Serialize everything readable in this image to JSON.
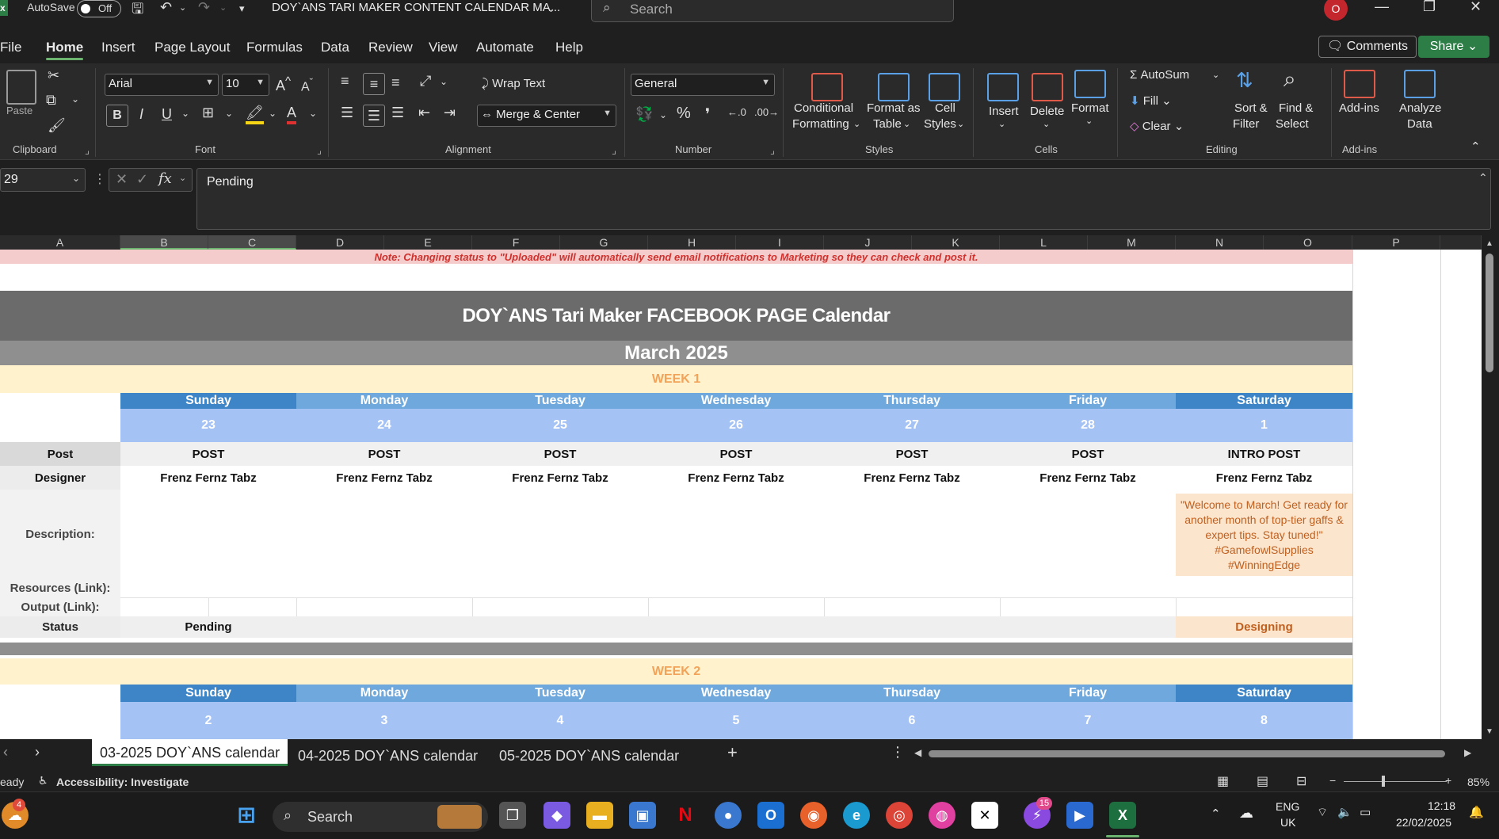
{
  "titlebar": {
    "autosave_label": "AutoSave",
    "autosave_state": "Off",
    "doc_title": "DOY`ANS TARI MAKER CONTENT CALENDAR MA...",
    "search_placeholder": "Search",
    "record_badge": "O"
  },
  "menu": [
    "File",
    "Home",
    "Insert",
    "Page Layout",
    "Formulas",
    "Data",
    "Review",
    "View",
    "Automate",
    "Help"
  ],
  "menu_active": "Home",
  "comments_label": "Comments",
  "share_label": "Share",
  "ribbon": {
    "clipboard": {
      "label": "Clipboard",
      "paste": "Paste"
    },
    "font": {
      "label": "Font",
      "name": "Arial",
      "size": "10"
    },
    "alignment": {
      "label": "Alignment",
      "wrap": "Wrap Text",
      "merge": "Merge & Center"
    },
    "number": {
      "label": "Number",
      "format": "General"
    },
    "styles": {
      "label": "Styles",
      "cond_line1": "Conditional",
      "cond_line2": "Formatting",
      "fmt_line1": "Format as",
      "fmt_line2": "Table",
      "cell_line1": "Cell",
      "cell_line2": "Styles"
    },
    "cells": {
      "label": "Cells",
      "insert": "Insert",
      "delete": "Delete",
      "format": "Format"
    },
    "editing": {
      "label": "Editing",
      "autosum": "AutoSum",
      "fill": "Fill",
      "clear": "Clear",
      "sort_line1": "Sort &",
      "sort_line2": "Filter",
      "find_line1": "Find &",
      "find_line2": "Select"
    },
    "addins": {
      "label": "Add-ins",
      "addins": "Add-ins",
      "analyze_line1": "Analyze",
      "analyze_line2": "Data"
    }
  },
  "formula_bar": {
    "name_box": "29",
    "content": "Pending"
  },
  "columns": [
    "A",
    "B",
    "C",
    "D",
    "E",
    "F",
    "G",
    "H",
    "I",
    "J",
    "K",
    "L",
    "M",
    "N",
    "O",
    "P"
  ],
  "sheet": {
    "note": "Note: Changing status to \"Uploaded\" will automatically send email notifications to Marketing so they can check and post it.",
    "title": "DOY`ANS Tari Maker FACEBOOK PAGE  Calendar",
    "month": "March 2025",
    "week1": {
      "label": "WEEK 1",
      "days": [
        "Sunday",
        "Monday",
        "Tuesday",
        "Wednesday",
        "Thursday",
        "Friday",
        "Saturday"
      ],
      "dates": [
        "23",
        "24",
        "25",
        "26",
        "27",
        "28",
        "1"
      ],
      "posts": [
        "POST",
        "POST",
        "POST",
        "POST",
        "POST",
        "POST",
        "INTRO POST"
      ],
      "designers": [
        "Frenz Fernz Tabz",
        "Frenz Fernz Tabz",
        "Frenz Fernz Tabz",
        "Frenz Fernz Tabz",
        "Frenz Fernz Tabz",
        "Frenz Fernz Tabz",
        "Frenz Fernz Tabz"
      ],
      "saturday_description": "\"Welcome to March! Get ready for another month of top-tier gaffs & expert tips. Stay tuned!\" #GamefowlSupplies #WinningEdge",
      "status_sunday": "Pending",
      "status_saturday": "Designing"
    },
    "row_labels": {
      "post": "Post",
      "designer": "Designer",
      "description": "Description:",
      "resources": "Resources (Link):",
      "output": "Output (Link):",
      "status": "Status"
    },
    "week2": {
      "label": "WEEK 2",
      "days": [
        "Sunday",
        "Monday",
        "Tuesday",
        "Wednesday",
        "Thursday",
        "Friday",
        "Saturday"
      ],
      "dates": [
        "2",
        "3",
        "4",
        "5",
        "6",
        "7",
        "8"
      ]
    }
  },
  "sheet_tabs": [
    "03-2025 DOY`ANS calendar",
    "04-2025 DOY`ANS calendar",
    "05-2025 DOY`ANS calendar"
  ],
  "status_bar": {
    "ready": "eady",
    "accessibility": "Accessibility: Investigate",
    "zoom": "85%"
  },
  "taskbar": {
    "search": "Search",
    "weather_badge": "4",
    "messenger_badge": "15",
    "lang1": "ENG",
    "lang2": "UK",
    "time": "12:18",
    "date": "22/02/2025"
  },
  "colors": {
    "dark_band": "#6b6b6b",
    "month_band": "#8f8f8f",
    "week_band": "#fff2cc",
    "day_dark": "#3d85c6",
    "day_light": "#6fa8dc",
    "date_band": "#a4c2f4",
    "saturday_desc": "#fce5cd",
    "label_gray": "#d9d9d9",
    "note_bg": "#f4cccc",
    "accent_green": "#2d7d46"
  }
}
